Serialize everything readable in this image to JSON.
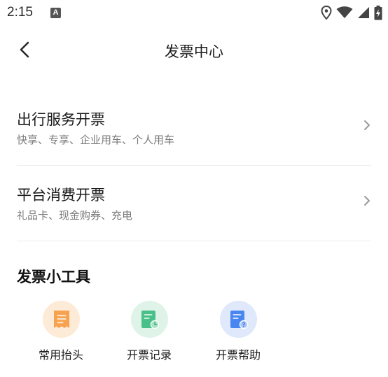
{
  "status_bar": {
    "time": "2:15",
    "notification_icon": "A"
  },
  "header": {
    "title": "发票中心",
    "back_icon": "chevron-left-icon"
  },
  "invoice_options": [
    {
      "title": "出行服务开票",
      "subtitle": "快享、专享、企业用车、个人用车"
    },
    {
      "title": "平台消费开票",
      "subtitle": "礼品卡、现金购券、充电"
    }
  ],
  "tools_section": {
    "title": "发票小工具",
    "items": [
      {
        "label": "常用抬头",
        "icon": "invoice-header-icon",
        "bg": "#fdebd7",
        "accent": "#f7a24f"
      },
      {
        "label": "开票记录",
        "icon": "invoice-record-icon",
        "bg": "#dff3e9",
        "accent": "#49c08a"
      },
      {
        "label": "开票帮助",
        "icon": "invoice-help-icon",
        "bg": "#dfe9fb",
        "accent": "#4a86f0"
      }
    ]
  },
  "colors": {
    "divider": "#eeeeee",
    "subtitle": "#7a7a7a",
    "chevron": "#9a9a9a"
  }
}
